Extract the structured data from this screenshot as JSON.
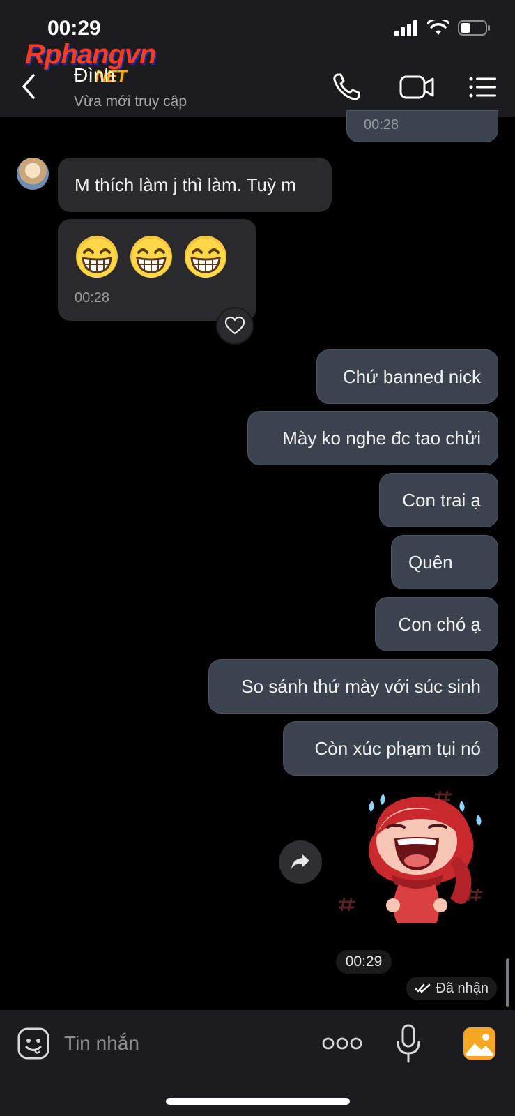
{
  "status_bar": {
    "time": "00:29"
  },
  "watermark": {
    "main": "Rphangvn",
    "sub": "NET"
  },
  "header": {
    "contact_name": "Đình",
    "contact_status": "Vừa mới truy cập"
  },
  "messages": {
    "prev_time": "00:28",
    "incoming": [
      {
        "text": "M thích làm j thì làm. Tuỳ m"
      },
      {
        "emoji": "😁😁😁",
        "time": "00:28"
      }
    ],
    "outgoing": [
      {
        "text": "Chứ banned nick"
      },
      {
        "text": "Mày ko nghe đc tao chửi"
      },
      {
        "text": "Con trai ạ"
      },
      {
        "text": "Quên"
      },
      {
        "text": "Con chó ạ"
      },
      {
        "text": "So sánh thứ mày với súc sinh"
      },
      {
        "text": "Còn xúc phạm tụi nó"
      }
    ],
    "sticker_time": "00:29",
    "read_status": "Đã nhận"
  },
  "composer": {
    "placeholder": "Tin nhắn"
  },
  "colors": {
    "background": "#000000",
    "header_bg": "#1c1c1e",
    "incoming_bubble": "#2a2a2c",
    "outgoing_bubble": "#3b434f",
    "image_button": "#f5a623"
  },
  "icons": {
    "back": "chevron-left-icon",
    "call": "phone-icon",
    "video": "video-camera-icon",
    "menu": "list-icon",
    "react": "heart-icon",
    "share": "share-arrow-icon",
    "sticker": "smiley-icon",
    "more": "three-dots-icon",
    "voice": "microphone-icon",
    "image": "image-icon"
  }
}
